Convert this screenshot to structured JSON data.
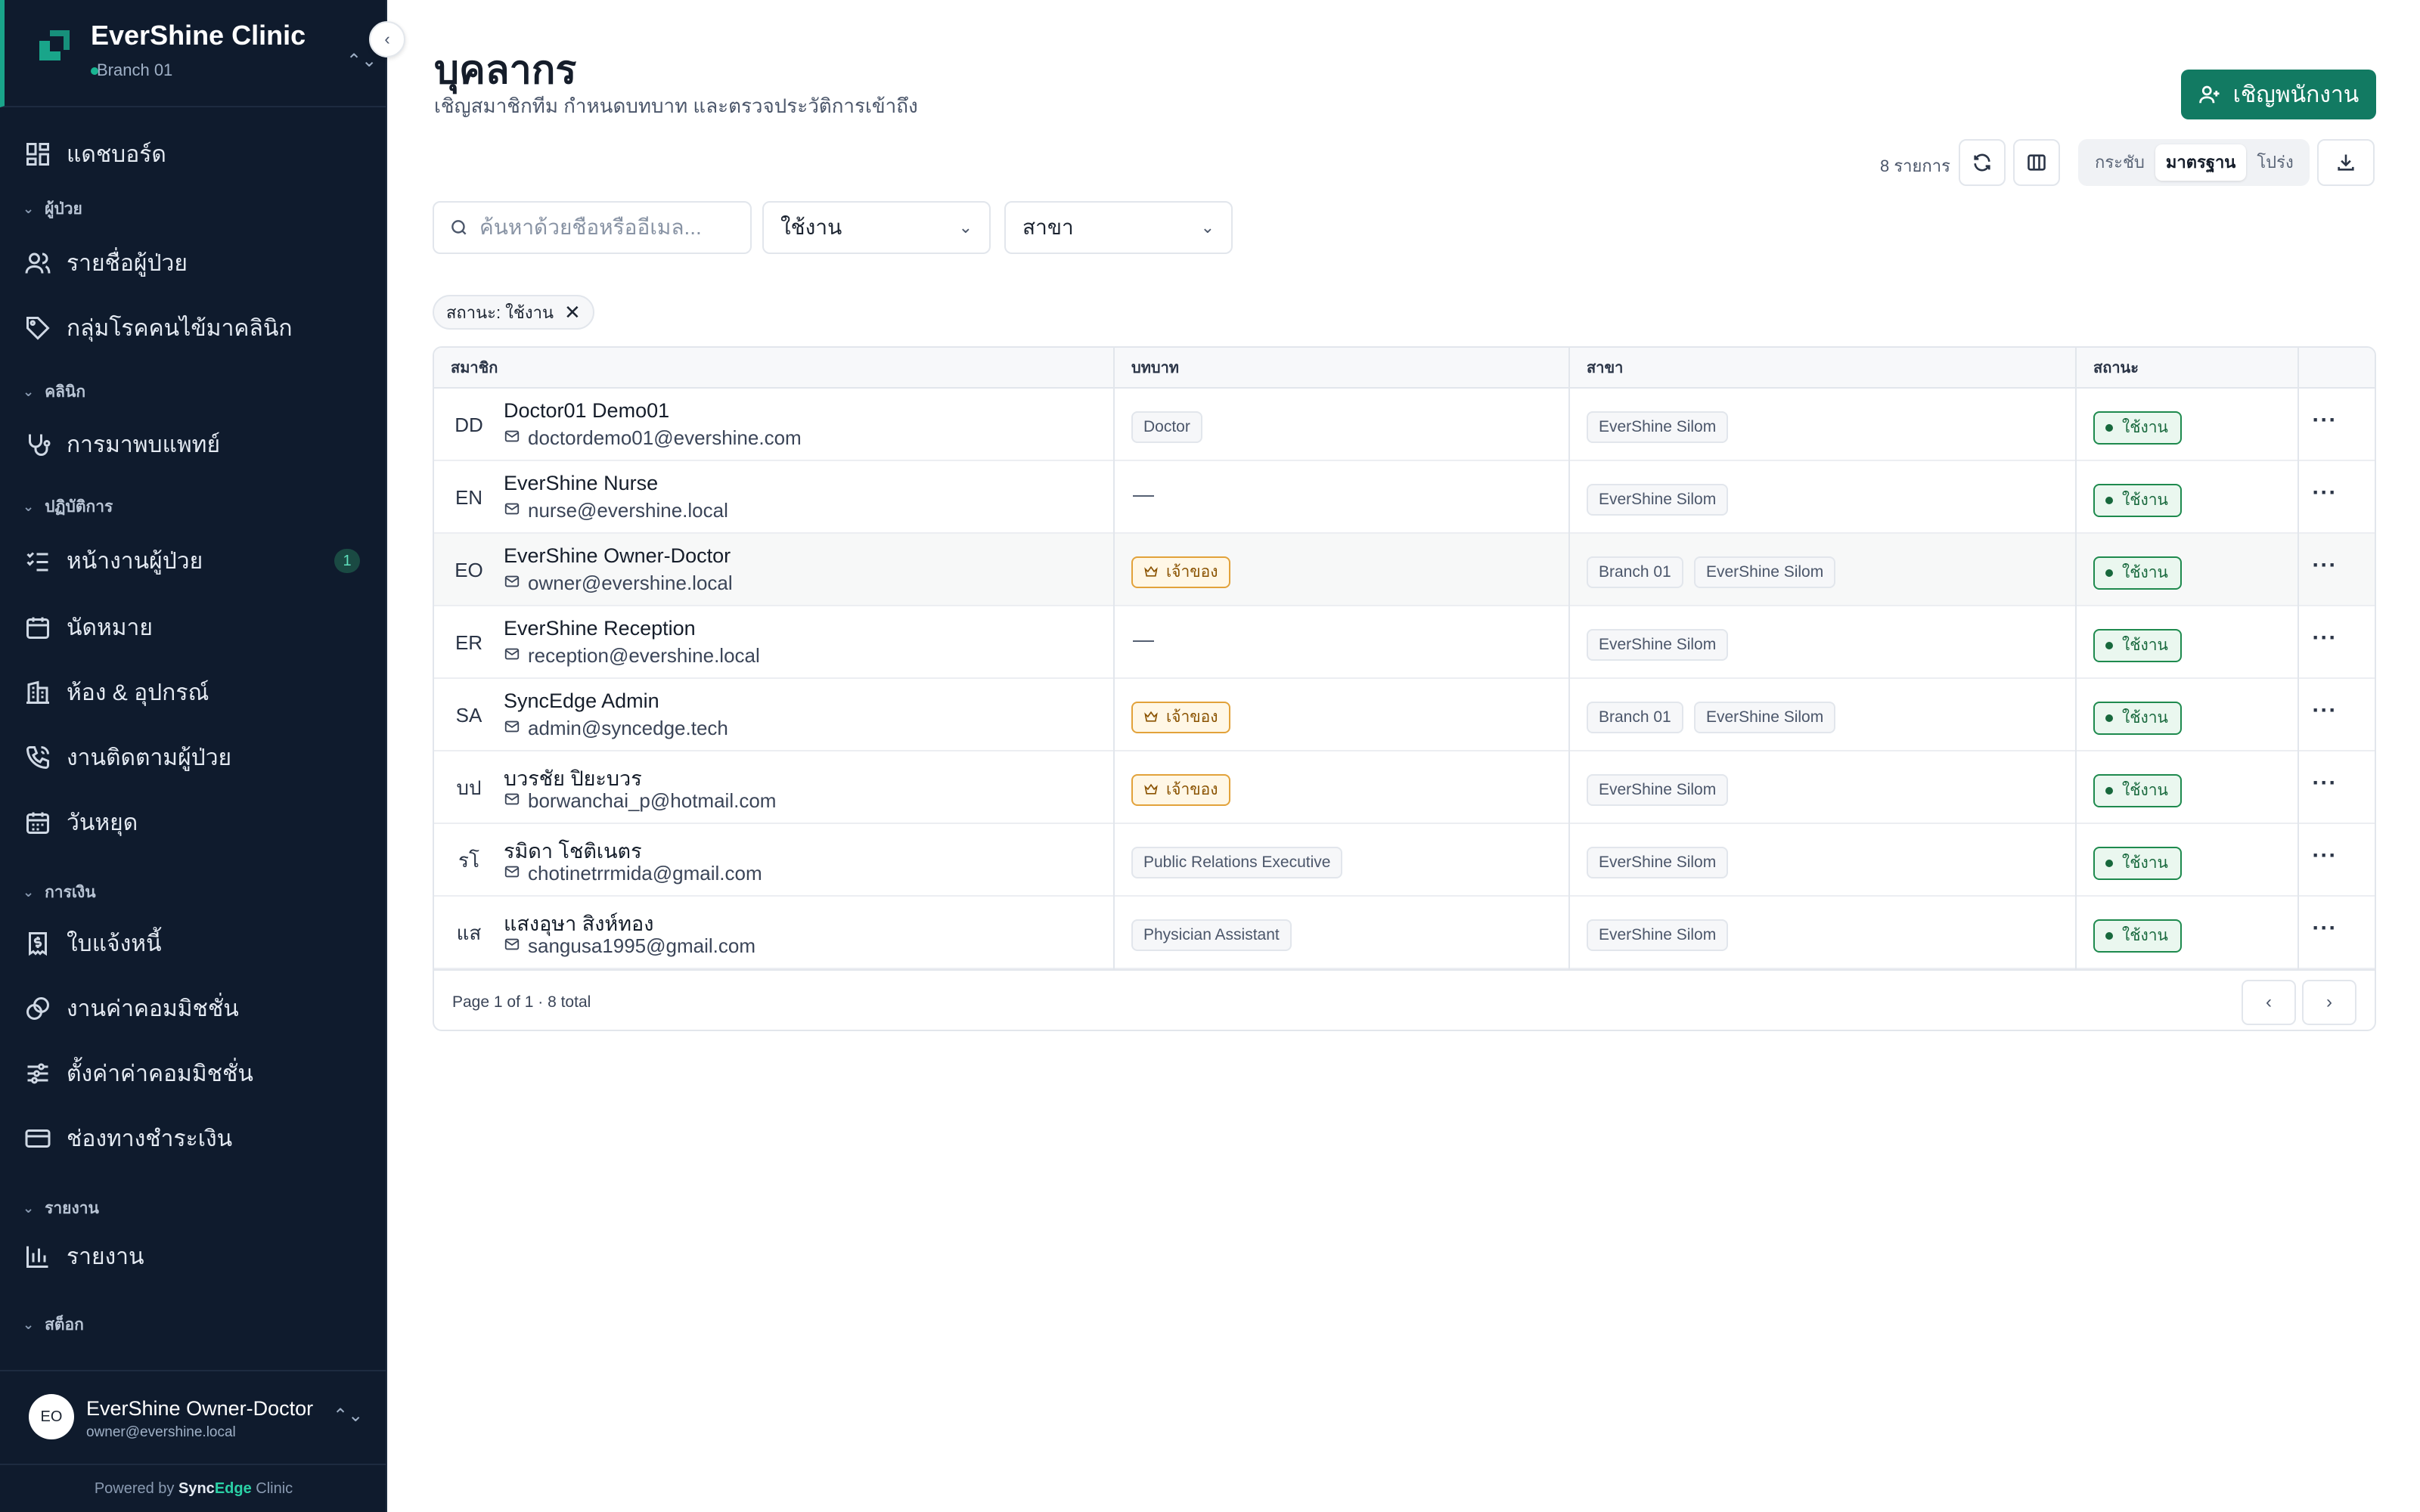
{
  "app": {
    "brand": "EverShine Clinic",
    "branch": "Branch 01",
    "accent_color": "#127a62",
    "sidebar_color": "#0f1b2d"
  },
  "sidebar": {
    "dashboard": "แดชบอร์ด",
    "sections": {
      "patients": "ผู้ป่วย",
      "clinic": "คลินิก",
      "operations": "ปฏิบัติการ",
      "finance": "การเงิน",
      "reports": "รายงาน",
      "stock": "สต็อก"
    },
    "items": {
      "patient_list": "รายชื่อผู้ป่วย",
      "disease_groups": "กลุ่มโรคคนไข้มาคลินิก",
      "doctor_visits": "การมาพบแพทย์",
      "patient_tasks": "หน้างานผู้ป่วย",
      "appointments": "นัดหมาย",
      "rooms_equipment": "ห้อง & อุปกรณ์",
      "followups": "งานติดตามผู้ป่วย",
      "holidays": "วันหยุด",
      "invoices": "ใบแจ้งหนี้",
      "commission_jobs": "งานค่าคอมมิชชั่น",
      "commission_settings": "ตั้งค่าค่าคอมมิชชั่น",
      "payment_channels": "ช่องทางชำระเงิน",
      "reports": "รายงาน"
    },
    "patient_tasks_badge": "1",
    "user": {
      "initials": "EO",
      "name": "EverShine Owner-Doctor",
      "email": "owner@evershine.local"
    },
    "powered_prefix": "Powered by",
    "powered_brand_a": "Sync",
    "powered_brand_b": "Edge",
    "powered_suffix": "Clinic"
  },
  "page": {
    "title": "บุคลากร",
    "subtitle": "เชิญสมาชิกทีม กำหนดบทบาท และตรวจประวัติการเข้าถึง",
    "invite_label": "เชิญพนักงาน"
  },
  "toolbar": {
    "count": "8 รายการ",
    "density_options": [
      "กระชับ",
      "มาตรฐาน",
      "โปร่ง"
    ],
    "density_selected": "มาตรฐาน"
  },
  "filters": {
    "search_placeholder": "ค้นหาด้วยชื่อหรืออีเมล...",
    "search_value": "",
    "status_value": "ใช้งาน",
    "branch_value": "สาขา",
    "active_chip": "สถานะ: ใช้งาน"
  },
  "table": {
    "headers": {
      "member": "สมาชิก",
      "role": "บทบาท",
      "branch": "สาขา",
      "status": "สถานะ"
    },
    "rows": [
      {
        "initials": "DD",
        "name": "Doctor01 Demo01",
        "email": "doctordemo01@evershine.com",
        "role": "Doctor",
        "role_type": "tag",
        "branches": [
          "EverShine Silom"
        ],
        "status": "ใช้งาน"
      },
      {
        "initials": "EN",
        "name": "EverShine Nurse",
        "email": "nurse@evershine.local",
        "role": "—",
        "role_type": "none",
        "branches": [
          "EverShine Silom"
        ],
        "status": "ใช้งาน"
      },
      {
        "initials": "EO",
        "name": "EverShine Owner-Doctor",
        "email": "owner@evershine.local",
        "role": "เจ้าของ",
        "role_type": "owner",
        "branches": [
          "Branch 01",
          "EverShine Silom"
        ],
        "status": "ใช้งาน"
      },
      {
        "initials": "ER",
        "name": "EverShine Reception",
        "email": "reception@evershine.local",
        "role": "—",
        "role_type": "none",
        "branches": [
          "EverShine Silom"
        ],
        "status": "ใช้งาน"
      },
      {
        "initials": "SA",
        "name": "SyncEdge Admin",
        "email": "admin@syncedge.tech",
        "role": "เจ้าของ",
        "role_type": "owner",
        "branches": [
          "Branch 01",
          "EverShine Silom"
        ],
        "status": "ใช้งาน"
      },
      {
        "initials": "บป",
        "name": "บวรชัย ปิยะบวร",
        "email": "borwanchai_p@hotmail.com",
        "role": "เจ้าของ",
        "role_type": "owner",
        "branches": [
          "EverShine Silom"
        ],
        "status": "ใช้งาน"
      },
      {
        "initials": "รโ",
        "name": "รมิดา โชติเนตร",
        "email": "chotinetrrmida@gmail.com",
        "role": "Public Relations Executive",
        "role_type": "tag",
        "branches": [
          "EverShine Silom"
        ],
        "status": "ใช้งาน"
      },
      {
        "initials": "แส",
        "name": "แสงอุษา สิงห์ทอง",
        "email": "sangusa1995@gmail.com",
        "role": "Physician Assistant",
        "role_type": "tag",
        "branches": [
          "EverShine Silom"
        ],
        "status": "ใช้งาน"
      }
    ],
    "footer": "Page 1 of 1 · 8 total"
  }
}
